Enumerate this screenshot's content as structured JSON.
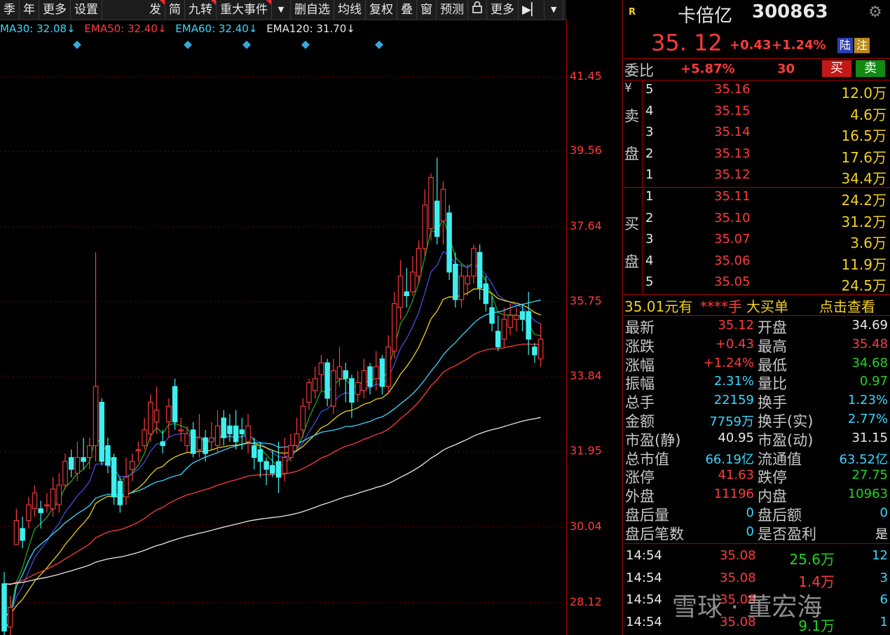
{
  "toolbar": {
    "items": [
      "季",
      "年",
      "更多",
      "设置"
    ],
    "items2": [
      "发",
      "简",
      "九转",
      "重大事件"
    ],
    "items3": [
      "删自选",
      "均线",
      "复权",
      "叠",
      "窗",
      "预测"
    ],
    "more": "更多"
  },
  "ema_legend": [
    {
      "text": "MA30: 32.08↓",
      "color": "#3ad7ff"
    },
    {
      "text": "EMA50: 32.40↓",
      "color": "#ff3b3b"
    },
    {
      "text": "EMA60: 32.40↓",
      "color": "#3ad7ff"
    },
    {
      "text": "EMA120: 31.70↓",
      "color": "#e8e8e8"
    }
  ],
  "chart_data": {
    "type": "candlestick",
    "y_ticks": [
      "41.45",
      "39.56",
      "37.64",
      "35.75",
      "33.84",
      "31.95",
      "30.04",
      "28.12"
    ],
    "ylim": [
      27.3,
      42.9
    ],
    "candles": [
      {
        "o": 28.6,
        "c": 27.4,
        "h": 28.9,
        "l": 27.3
      },
      {
        "o": 27.5,
        "c": 28.0,
        "h": 28.3,
        "l": 27.3
      },
      {
        "o": 29.6,
        "c": 30.2,
        "h": 30.5,
        "l": 29.6
      },
      {
        "o": 30.0,
        "c": 29.7,
        "h": 30.3,
        "l": 29.5
      },
      {
        "o": 30.2,
        "c": 30.6,
        "h": 30.8,
        "l": 30.0
      },
      {
        "o": 30.5,
        "c": 30.9,
        "h": 31.1,
        "l": 30.3
      },
      {
        "o": 30.5,
        "c": 30.4,
        "h": 30.7,
        "l": 30.0
      },
      {
        "o": 30.6,
        "c": 30.6,
        "h": 30.9,
        "l": 30.4
      },
      {
        "o": 30.5,
        "c": 31.0,
        "h": 31.3,
        "l": 30.3
      },
      {
        "o": 30.6,
        "c": 31.1,
        "h": 31.4,
        "l": 30.4
      },
      {
        "o": 31.1,
        "c": 31.7,
        "h": 31.9,
        "l": 31.0
      },
      {
        "o": 31.8,
        "c": 31.5,
        "h": 32.0,
        "l": 31.3
      },
      {
        "o": 31.4,
        "c": 31.8,
        "h": 32.2,
        "l": 31.2
      },
      {
        "o": 31.8,
        "c": 31.7,
        "h": 32.3,
        "l": 31.5
      },
      {
        "o": 31.8,
        "c": 32.1,
        "h": 32.3,
        "l": 31.5
      },
      {
        "o": 32.1,
        "c": 33.6,
        "h": 37.0,
        "l": 31.7
      },
      {
        "o": 33.2,
        "c": 31.7,
        "h": 33.3,
        "l": 31.6
      },
      {
        "o": 32.1,
        "c": 31.6,
        "h": 32.3,
        "l": 31.4
      },
      {
        "o": 31.8,
        "c": 30.8,
        "h": 31.9,
        "l": 30.6
      },
      {
        "o": 31.2,
        "c": 30.6,
        "h": 31.3,
        "l": 30.4
      },
      {
        "o": 30.8,
        "c": 31.3,
        "h": 31.8,
        "l": 30.6
      },
      {
        "o": 31.5,
        "c": 31.7,
        "h": 31.9,
        "l": 31.2
      },
      {
        "o": 32.0,
        "c": 32.0,
        "h": 32.2,
        "l": 31.7
      },
      {
        "o": 32.1,
        "c": 32.5,
        "h": 32.8,
        "l": 32.0
      },
      {
        "o": 32.4,
        "c": 33.2,
        "h": 33.4,
        "l": 32.2
      },
      {
        "o": 32.7,
        "c": 33.0,
        "h": 33.6,
        "l": 32.4
      },
      {
        "o": 32.2,
        "c": 32.1,
        "h": 32.5,
        "l": 31.9
      },
      {
        "o": 32.7,
        "c": 33.1,
        "h": 33.3,
        "l": 32.3
      },
      {
        "o": 33.6,
        "c": 32.7,
        "h": 33.8,
        "l": 32.5
      },
      {
        "o": 32.5,
        "c": 32.5,
        "h": 32.8,
        "l": 32.2
      },
      {
        "o": 32.1,
        "c": 32.4,
        "h": 32.6,
        "l": 31.9
      },
      {
        "o": 32.5,
        "c": 31.9,
        "h": 32.7,
        "l": 31.8
      },
      {
        "o": 32.0,
        "c": 32.3,
        "h": 32.9,
        "l": 31.8
      },
      {
        "o": 32.3,
        "c": 31.9,
        "h": 32.5,
        "l": 31.7
      },
      {
        "o": 32.2,
        "c": 32.3,
        "h": 32.7,
        "l": 32.0
      },
      {
        "o": 32.1,
        "c": 32.6,
        "h": 33.0,
        "l": 31.9
      },
      {
        "o": 32.8,
        "c": 32.3,
        "h": 33.0,
        "l": 32.1
      },
      {
        "o": 32.6,
        "c": 32.4,
        "h": 32.9,
        "l": 32.2
      },
      {
        "o": 32.6,
        "c": 32.2,
        "h": 33.0,
        "l": 32.0
      },
      {
        "o": 32.5,
        "c": 32.4,
        "h": 32.8,
        "l": 32.0
      },
      {
        "o": 32.2,
        "c": 32.6,
        "h": 32.9,
        "l": 31.9
      },
      {
        "o": 32.1,
        "c": 31.8,
        "h": 32.3,
        "l": 31.5
      },
      {
        "o": 32.0,
        "c": 31.7,
        "h": 32.2,
        "l": 31.3
      },
      {
        "o": 31.7,
        "c": 31.5,
        "h": 31.8,
        "l": 31.1
      },
      {
        "o": 31.6,
        "c": 31.4,
        "h": 32.0,
        "l": 31.3
      },
      {
        "o": 31.7,
        "c": 31.3,
        "h": 32.2,
        "l": 30.9
      },
      {
        "o": 31.4,
        "c": 31.8,
        "h": 32.3,
        "l": 31.2
      },
      {
        "o": 31.8,
        "c": 32.1,
        "h": 32.4,
        "l": 31.7
      },
      {
        "o": 32.1,
        "c": 32.4,
        "h": 32.8,
        "l": 32.0
      },
      {
        "o": 32.5,
        "c": 33.1,
        "h": 33.3,
        "l": 32.3
      },
      {
        "o": 33.2,
        "c": 33.7,
        "h": 33.8,
        "l": 33.0
      },
      {
        "o": 33.5,
        "c": 33.8,
        "h": 34.1,
        "l": 33.3
      },
      {
        "o": 33.9,
        "c": 34.2,
        "h": 34.4,
        "l": 33.5
      },
      {
        "o": 34.2,
        "c": 33.3,
        "h": 34.3,
        "l": 33.1
      },
      {
        "o": 33.1,
        "c": 34.0,
        "h": 34.3,
        "l": 32.9
      },
      {
        "o": 33.8,
        "c": 34.1,
        "h": 34.6,
        "l": 33.6
      },
      {
        "o": 34.0,
        "c": 33.8,
        "h": 34.2,
        "l": 33.2
      },
      {
        "o": 33.8,
        "c": 33.2,
        "h": 33.9,
        "l": 32.8
      },
      {
        "o": 33.4,
        "c": 33.7,
        "h": 34.0,
        "l": 33.2
      },
      {
        "o": 33.5,
        "c": 34.0,
        "h": 34.3,
        "l": 33.3
      },
      {
        "o": 34.1,
        "c": 33.6,
        "h": 34.2,
        "l": 33.4
      },
      {
        "o": 33.8,
        "c": 34.1,
        "h": 34.5,
        "l": 33.5
      },
      {
        "o": 34.3,
        "c": 33.6,
        "h": 34.4,
        "l": 33.4
      },
      {
        "o": 33.6,
        "c": 34.6,
        "h": 34.9,
        "l": 33.4
      },
      {
        "o": 34.5,
        "c": 35.7,
        "h": 36.0,
        "l": 34.3
      },
      {
        "o": 35.6,
        "c": 36.4,
        "h": 36.8,
        "l": 35.3
      },
      {
        "o": 36.0,
        "c": 35.9,
        "h": 36.6,
        "l": 35.6
      },
      {
        "o": 36.0,
        "c": 36.5,
        "h": 36.9,
        "l": 35.9
      },
      {
        "o": 36.4,
        "c": 37.1,
        "h": 37.3,
        "l": 36.2
      },
      {
        "o": 37.1,
        "c": 38.2,
        "h": 38.6,
        "l": 36.9
      },
      {
        "o": 37.6,
        "c": 38.9,
        "h": 39.0,
        "l": 37.3
      },
      {
        "o": 38.3,
        "c": 37.4,
        "h": 39.4,
        "l": 37.2
      },
      {
        "o": 37.8,
        "c": 38.6,
        "h": 38.8,
        "l": 37.2
      },
      {
        "o": 38.0,
        "c": 36.5,
        "h": 38.2,
        "l": 36.3
      },
      {
        "o": 36.7,
        "c": 35.8,
        "h": 37.0,
        "l": 35.6
      },
      {
        "o": 35.8,
        "c": 36.4,
        "h": 36.7,
        "l": 35.6
      },
      {
        "o": 36.2,
        "c": 36.4,
        "h": 36.7,
        "l": 35.9
      },
      {
        "o": 36.4,
        "c": 37.1,
        "h": 37.2,
        "l": 36.2
      },
      {
        "o": 37.0,
        "c": 36.1,
        "h": 37.2,
        "l": 35.8
      },
      {
        "o": 36.2,
        "c": 35.7,
        "h": 36.4,
        "l": 35.5
      },
      {
        "o": 35.6,
        "c": 35.2,
        "h": 35.9,
        "l": 35.0
      },
      {
        "o": 35.0,
        "c": 34.6,
        "h": 35.4,
        "l": 34.5
      },
      {
        "o": 34.8,
        "c": 35.3,
        "h": 35.6,
        "l": 34.6
      },
      {
        "o": 35.1,
        "c": 35.4,
        "h": 35.7,
        "l": 34.9
      },
      {
        "o": 35.3,
        "c": 35.4,
        "h": 35.6,
        "l": 35.0
      },
      {
        "o": 35.5,
        "c": 35.3,
        "h": 35.7,
        "l": 35.0
      },
      {
        "o": 35.5,
        "c": 34.8,
        "h": 36.0,
        "l": 34.4
      },
      {
        "o": 34.6,
        "c": 34.4,
        "h": 34.7,
        "l": 34.2
      },
      {
        "o": 34.3,
        "c": 34.8,
        "h": 35.2,
        "l": 34.1
      }
    ]
  },
  "panel": {
    "header": {
      "badge": "R",
      "name": "卡倍亿",
      "code": "300863"
    },
    "price": {
      "last": "35. 12",
      "chg": "+0.43",
      "pct": "+1.24%",
      "tag1": "陆",
      "tag2": "注"
    },
    "weibi": {
      "label": "委比",
      "pct": "+5.87%",
      "diff": "30",
      "buy": "买",
      "sell": "卖"
    },
    "sell_side": {
      "label": [
        "¥",
        "卖",
        "盘"
      ],
      "levels": [
        {
          "n": "5",
          "p": "35.16",
          "v": "12.0万"
        },
        {
          "n": "4",
          "p": "35.15",
          "v": "4.6万"
        },
        {
          "n": "3",
          "p": "35.14",
          "v": "16.5万"
        },
        {
          "n": "2",
          "p": "35.13",
          "v": "17.6万"
        },
        {
          "n": "1",
          "p": "35.12",
          "v": "34.4万"
        }
      ]
    },
    "buy_side": {
      "label": [
        "买",
        "盘"
      ],
      "levels": [
        {
          "n": "1",
          "p": "35.11",
          "v": "24.2万"
        },
        {
          "n": "2",
          "p": "35.10",
          "v": "31.2万"
        },
        {
          "n": "3",
          "p": "35.07",
          "v": "3.6万"
        },
        {
          "n": "4",
          "p": "35.06",
          "v": "11.9万"
        },
        {
          "n": "5",
          "p": "35.05",
          "v": "24.5万"
        }
      ]
    },
    "bigorder": {
      "price": "35.01元有",
      "hand": "****手",
      "text": "大买单",
      "link": "点击查看"
    },
    "stats": [
      {
        "l1": "最新",
        "v1": "35.12",
        "c1": "red",
        "l2": "开盘",
        "v2": "34.69",
        "c2": "white"
      },
      {
        "l1": "涨跌",
        "v1": "+0.43",
        "c1": "red",
        "l2": "最高",
        "v2": "35.48",
        "c2": "red"
      },
      {
        "l1": "涨幅",
        "v1": "+1.24%",
        "c1": "red",
        "l2": "最低",
        "v2": "34.68",
        "c2": "green"
      },
      {
        "l1": "振幅",
        "v1": "2.31%",
        "c1": "cyan",
        "l2": "量比",
        "v2": "0.97",
        "c2": "green"
      },
      {
        "l1": "总手",
        "v1": "22159",
        "c1": "cyan",
        "l2": "换手",
        "v2": "1.23%",
        "c2": "cyan"
      },
      {
        "l1": "金额",
        "v1": "7759万",
        "c1": "cyan",
        "l2": "换手(实)",
        "v2": "2.77%",
        "c2": "cyan"
      },
      {
        "l1": "市盈(静)",
        "v1": "40.95",
        "c1": "white",
        "l2": "市盈(动)",
        "v2": "31.15",
        "c2": "white"
      },
      {
        "l1": "总市值",
        "v1": "66.19亿",
        "c1": "cyan",
        "l2": "流通值",
        "v2": "63.52亿",
        "c2": "cyan"
      },
      {
        "l1": "涨停",
        "v1": "41.63",
        "c1": "red",
        "l2": "跌停",
        "v2": "27.75",
        "c2": "green"
      },
      {
        "l1": "外盘",
        "v1": "11196",
        "c1": "red",
        "l2": "内盘",
        "v2": "10963",
        "c2": "green"
      },
      {
        "l1": "盘后量",
        "v1": "0",
        "c1": "cyan",
        "l2": "盘后额",
        "v2": "0",
        "c2": "cyan"
      },
      {
        "l1": "盘后笔数",
        "v1": "0",
        "c1": "cyan",
        "l2": "是否盈利",
        "v2": "是",
        "c2": "white"
      }
    ],
    "ticks": [
      {
        "t": "14:54",
        "p": "35.08",
        "v": "25.6万",
        "vc": "green",
        "n": "12"
      },
      {
        "t": "14:54",
        "p": "35.08",
        "v": "1.4万",
        "vc": "red",
        "n": "3"
      },
      {
        "t": "14:54",
        "p": "35.08",
        "v": "",
        "vc": "red",
        "n": "6"
      },
      {
        "t": "14:54",
        "p": "35.08",
        "v": "9.1万",
        "vc": "green",
        "n": "1"
      }
    ],
    "watermark": "雪球 · 董宏海"
  }
}
